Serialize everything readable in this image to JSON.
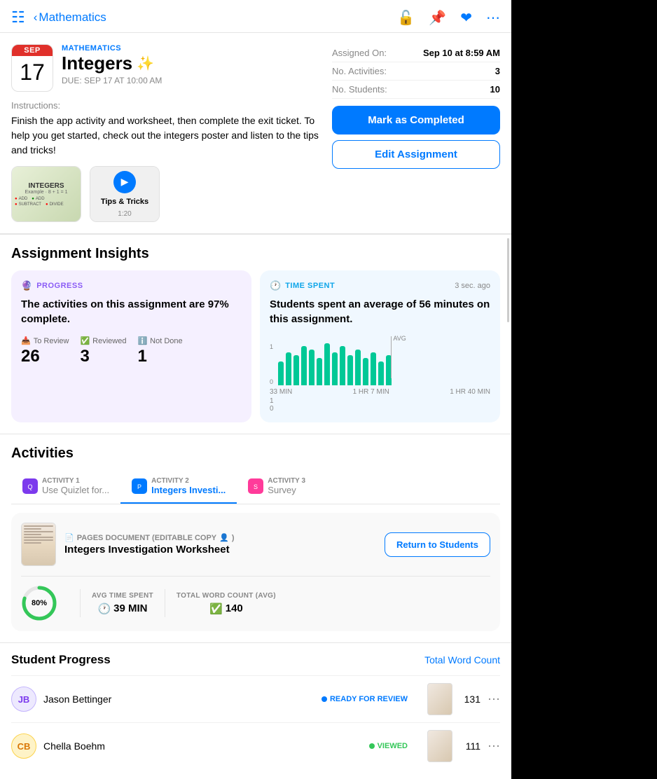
{
  "header": {
    "back_label": "Mathematics",
    "icons": [
      "unlock-icon",
      "pin-icon",
      "heart-icon",
      "more-icon"
    ]
  },
  "assignment": {
    "month": "SEP",
    "day": "17",
    "subject": "MATHEMATICS",
    "title": "Integers",
    "sparkle": "✨",
    "due_date": "DUE: SEP 17 AT 10:00 AM",
    "assigned_on_label": "Assigned On:",
    "assigned_on_value": "Sep 10 at 8:59 AM",
    "no_activities_label": "No. Activities:",
    "no_activities_value": "3",
    "no_students_label": "No. Students:",
    "no_students_value": "10"
  },
  "buttons": {
    "mark_completed": "Mark as Completed",
    "edit_assignment": "Edit Assignment",
    "return_to_students": "Return to Students"
  },
  "instructions": {
    "label": "Instructions:",
    "text": "Finish the app activity and worksheet, then complete the exit ticket. To help you get started, check out the integers poster and listen to the tips and tricks!"
  },
  "attachments": [
    {
      "type": "image",
      "title": "INTEGERS",
      "subtitle": "Example"
    },
    {
      "type": "video",
      "title": "Tips & Tricks",
      "duration": "1:20"
    }
  ],
  "insights": {
    "title": "Assignment Insights",
    "progress_card": {
      "type_label": "PROGRESS",
      "description": "The activities on this assignment are 97% complete.",
      "stats": [
        {
          "icon": "📥",
          "label": "To Review",
          "value": "26"
        },
        {
          "icon": "✅",
          "label": "Reviewed",
          "value": "3"
        },
        {
          "icon": "ℹ️",
          "label": "Not Done",
          "value": "1"
        }
      ]
    },
    "time_card": {
      "type_label": "TIME SPENT",
      "timestamp": "3 sec. ago",
      "description": "Students spent an average of 56 minutes on this assignment.",
      "chart_bars": [
        40,
        55,
        50,
        65,
        60,
        45,
        70,
        55,
        65,
        50,
        60,
        45,
        55,
        40,
        50
      ],
      "chart_labels": [
        "33 MIN",
        "1 HR 7 MIN",
        "1 HR 40 MIN"
      ],
      "avg_position": "AVG"
    }
  },
  "activities": {
    "title": "Activities",
    "tabs": [
      {
        "num": "ACTIVITY 1",
        "name": "Use Quizlet for...",
        "icon_color": "purple",
        "active": false
      },
      {
        "num": "ACTIVITY 2",
        "name": "Integers Investi...",
        "icon_color": "blue",
        "active": true
      },
      {
        "num": "ACTIVITY 3",
        "name": "Survey",
        "icon_color": "pink",
        "active": false
      }
    ],
    "active_content": {
      "doc_type": "PAGES DOCUMENT (EDITABLE COPY",
      "doc_name": "Integers Investigation Worksheet",
      "avg_time_label": "AVG TIME SPENT",
      "avg_time_value": "39 MIN",
      "word_count_label": "TOTAL WORD COUNT (AVG)",
      "word_count_value": "140",
      "progress_pct": "80%",
      "progress_value": 80
    }
  },
  "student_progress": {
    "title": "Student Progress",
    "word_count_link": "Total Word Count",
    "students": [
      {
        "initials": "JB",
        "name": "Jason Bettinger",
        "status": "READY FOR REVIEW",
        "status_type": "blue",
        "word_count": "131"
      },
      {
        "initials": "CB",
        "name": "Chella Boehm",
        "status": "VIEWED",
        "status_type": "green",
        "word_count": "111"
      }
    ]
  }
}
